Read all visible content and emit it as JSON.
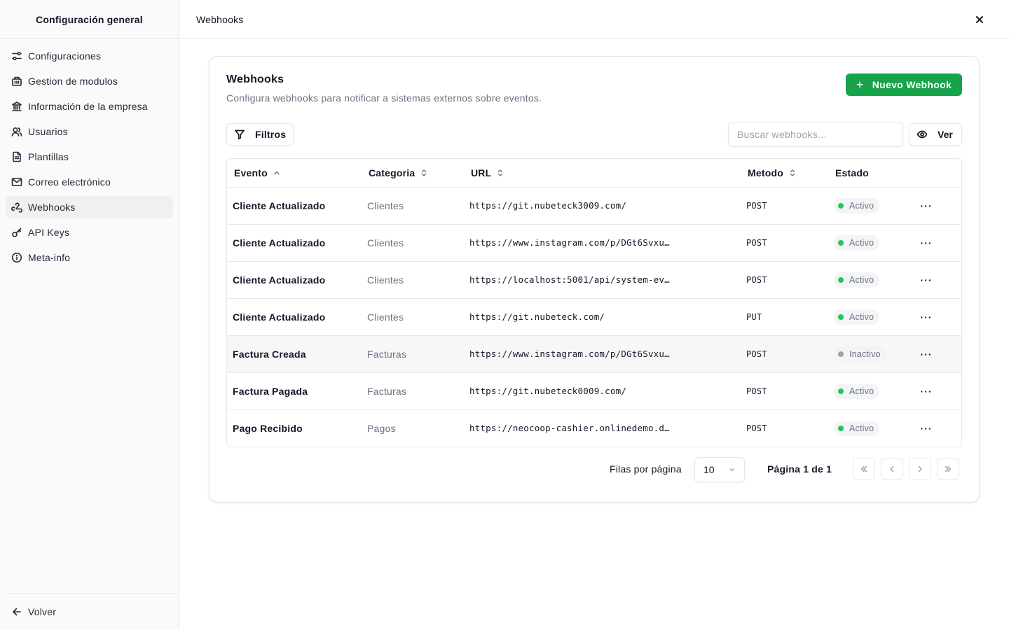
{
  "sidebar": {
    "title": "Configuración general",
    "items": [
      {
        "label": "Configuraciones",
        "icon": "settings-sliders-icon"
      },
      {
        "label": "Gestion de modulos",
        "icon": "modules-icon"
      },
      {
        "label": "Información de la empresa",
        "icon": "bank-icon"
      },
      {
        "label": "Usuarios",
        "icon": "users-icon"
      },
      {
        "label": "Plantillas",
        "icon": "file-icon"
      },
      {
        "label": "Correo electrónico",
        "icon": "mail-icon"
      },
      {
        "label": "Webhooks",
        "icon": "webhook-icon"
      },
      {
        "label": "API Keys",
        "icon": "key-icon"
      },
      {
        "label": "Meta-info",
        "icon": "info-icon"
      }
    ],
    "active": "Webhooks",
    "back_label": "Volver"
  },
  "topbar": {
    "title": "Webhooks"
  },
  "card": {
    "title": "Webhooks",
    "subtitle": "Configura webhooks para notificar a sistemas externos sobre eventos.",
    "new_button": "Nuevo Webhook",
    "filters_button": "Filtros",
    "search_placeholder": "Buscar webhooks...",
    "view_button": "Ver"
  },
  "table": {
    "headers": {
      "event": "Evento",
      "category": "Categoria",
      "url": "URL",
      "method": "Metodo",
      "status": "Estado"
    },
    "rows": [
      {
        "event": "Cliente Actualizado",
        "category": "Clientes",
        "url": "https://git.nubeteck3009.com/",
        "method": "POST",
        "status": "Activo"
      },
      {
        "event": "Cliente Actualizado",
        "category": "Clientes",
        "url": "https://www.instagram.com/p/DGt6Svxu…",
        "method": "POST",
        "status": "Activo"
      },
      {
        "event": "Cliente Actualizado",
        "category": "Clientes",
        "url": "https://localhost:5001/api/system-ev…",
        "method": "POST",
        "status": "Activo"
      },
      {
        "event": "Cliente Actualizado",
        "category": "Clientes",
        "url": "https://git.nubeteck.com/",
        "method": "PUT",
        "status": "Activo"
      },
      {
        "event": "Factura Creada",
        "category": "Facturas",
        "url": "https://www.instagram.com/p/DGt6Svxu…",
        "method": "POST",
        "status": "Inactivo"
      },
      {
        "event": "Factura Pagada",
        "category": "Facturas",
        "url": "https://git.nubeteck0009.com/",
        "method": "POST",
        "status": "Activo"
      },
      {
        "event": "Pago Recibido",
        "category": "Pagos",
        "url": "https://neocoop-cashier.onlinedemo.d…",
        "method": "POST",
        "status": "Activo"
      }
    ]
  },
  "pagination": {
    "rows_label": "Filas por página",
    "rows_value": "10",
    "page_label": "Página 1 de 1"
  },
  "colors": {
    "accent": "#16a34a",
    "active_dot": "#22c55e",
    "inactive_dot": "#9ca3af"
  }
}
